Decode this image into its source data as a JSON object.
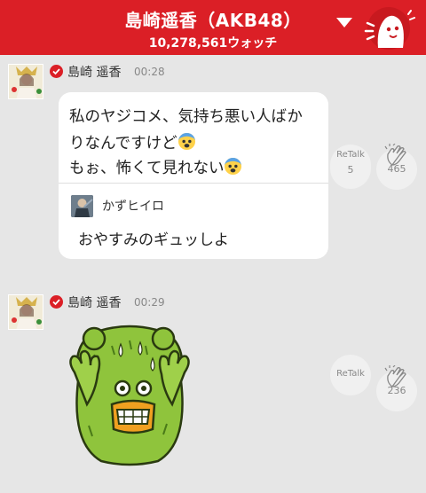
{
  "header": {
    "title": "島崎遥香（AKB48）",
    "watch_count": "10,278,561ウォッチ",
    "accent_color": "#db1f26",
    "icons": [
      "dropdown-arrow-icon",
      "mascot-icon"
    ]
  },
  "posts": [
    {
      "author": "島崎 遥香",
      "time": "00:28",
      "message_lines": [
        {
          "text": "私のヤジコメ、気持ち悪い人ばか",
          "emoji": false
        },
        {
          "text": "りなんですけど",
          "emoji": true
        },
        {
          "text": "もぉ、怖くて見れない",
          "emoji": true
        }
      ],
      "quote": {
        "author": "かずヒイロ",
        "text": "おやすみのギュッしよ"
      },
      "retalk_label": "ReTalk",
      "retalk_count": "5",
      "clap_count": "465"
    },
    {
      "author": "島崎 遥香",
      "time": "00:29",
      "sticker": "scared-frog-sticker",
      "retalk_label": "ReTalk",
      "retalk_count": "",
      "clap_count": "236"
    }
  ]
}
